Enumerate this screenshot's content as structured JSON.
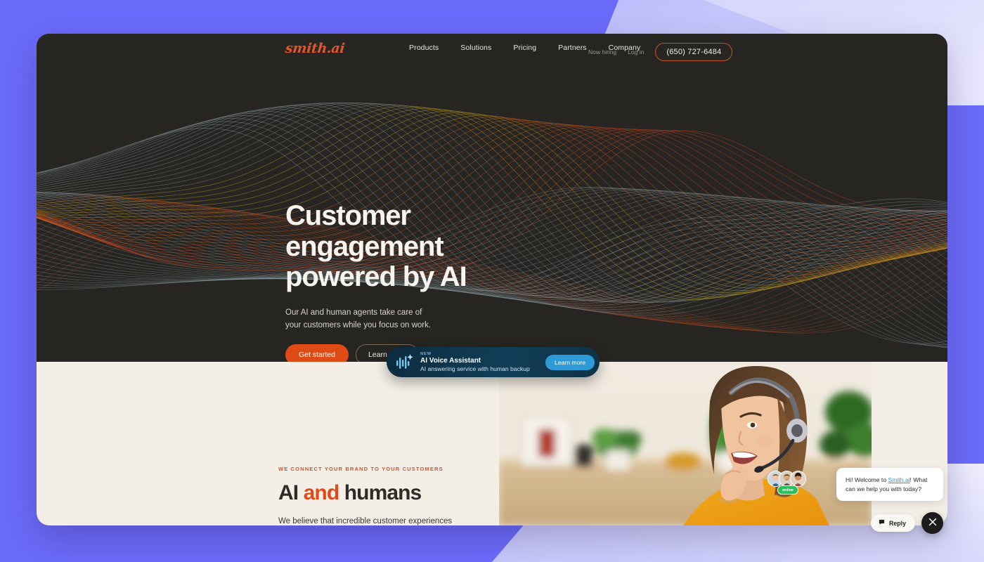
{
  "page": {
    "background_color": "#6B6BFB",
    "card_background": "#272522",
    "accent_orange": "#DF4B17",
    "cream": "#F3EFE6"
  },
  "nav": {
    "logo": "smith.ai",
    "links": [
      {
        "label": "Products"
      },
      {
        "label": "Solutions"
      },
      {
        "label": "Pricing"
      },
      {
        "label": "Partners"
      },
      {
        "label": "Company"
      }
    ],
    "now_hiring": "Now hiring",
    "log_in": "Log in",
    "phone": "(650) 727-6484"
  },
  "hero": {
    "heading_line1": "Customer",
    "heading_line2": "engagement",
    "heading_line3": "powered by AI",
    "subtext": "Our AI and human agents take care of your customers while you focus on work.",
    "primary_button": "Get started",
    "secondary_button": "Learn more"
  },
  "voice_banner": {
    "badge": "NEW",
    "title": "AI Voice Assistant",
    "subtitle": "AI answering service with human backup",
    "button": "Learn more",
    "icon": "waveform-sparkle-icon",
    "accent": "#2E9BD8"
  },
  "section": {
    "eyebrow": "WE CONNECT YOUR BRAND TO YOUR CUSTOMERS",
    "heading_part1": "AI ",
    "heading_accent": "and",
    "heading_part2": " humans",
    "body": "We believe that incredible customer experiences"
  },
  "chat": {
    "message_prefix": "Hi! Welcome to ",
    "message_link": "Smith.ai",
    "message_suffix": "! What can we help you with today?",
    "online_label": "online",
    "reply_label": "Reply",
    "close_label": "×",
    "online_color": "#2BBF5E"
  }
}
